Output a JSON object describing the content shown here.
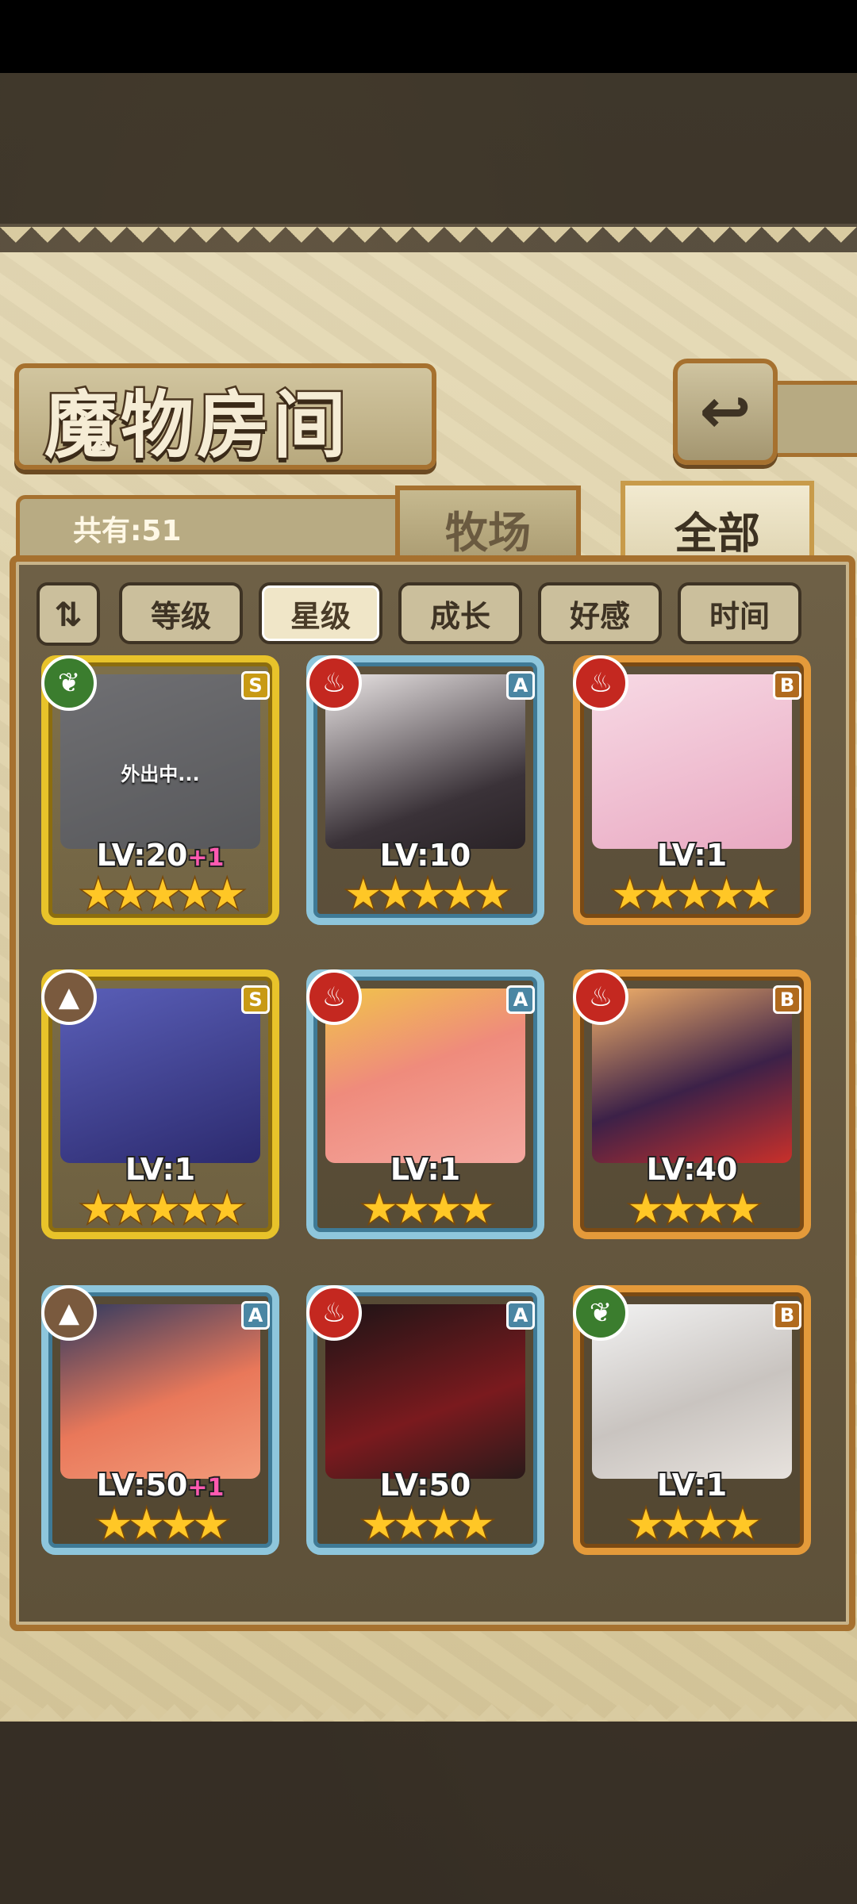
{
  "title": "魔物房间",
  "back_icon": "return-arrow-icon",
  "count": {
    "label": "共有:51"
  },
  "tabs": [
    {
      "label": "牧场",
      "active": false
    },
    {
      "label": "全部",
      "active": true
    }
  ],
  "sort_icon": "sort-order-icon",
  "sort_buttons": [
    {
      "label": "等级",
      "active": false
    },
    {
      "label": "星级",
      "active": true
    },
    {
      "label": "成长",
      "active": false
    },
    {
      "label": "好感",
      "active": false
    },
    {
      "label": "时间",
      "active": false
    }
  ],
  "colors": {
    "frame_S": "#e8c32a",
    "frame_A": "#8ec6dc",
    "frame_B": "#e49a3a",
    "element_green": "#3b7d2e",
    "element_red": "#c42820",
    "element_brown": "#7a5a3e",
    "bonus": "#ff5ab0"
  },
  "monsters": [
    {
      "rank": "S",
      "element": "leaf-element-icon",
      "level": "LV:20",
      "bonus": "+1",
      "stars": "★★★★★",
      "status": "外出中..."
    },
    {
      "rank": "A",
      "element": "fire-element-icon",
      "level": "LV:10",
      "bonus": "",
      "stars": "★★★★★",
      "status": ""
    },
    {
      "rank": "B",
      "element": "fire-element-icon",
      "level": "LV:1",
      "bonus": "",
      "stars": "★★★★★",
      "status": ""
    },
    {
      "rank": "S",
      "element": "mountain-element-icon",
      "level": "LV:1",
      "bonus": "",
      "stars": "★★★★★",
      "status": ""
    },
    {
      "rank": "A",
      "element": "fire-element-icon",
      "level": "LV:1",
      "bonus": "",
      "stars": "★★★★",
      "status": ""
    },
    {
      "rank": "B",
      "element": "fire-element-icon",
      "level": "LV:40",
      "bonus": "",
      "stars": "★★★★",
      "status": ""
    },
    {
      "rank": "A",
      "element": "mountain-element-icon",
      "level": "LV:50",
      "bonus": "+1",
      "stars": "★★★★",
      "status": ""
    },
    {
      "rank": "A",
      "element": "fire-element-icon",
      "level": "LV:50",
      "bonus": "",
      "stars": "★★★★",
      "status": ""
    },
    {
      "rank": "B",
      "element": "leaf-element-icon",
      "level": "LV:1",
      "bonus": "",
      "stars": "★★★★",
      "status": ""
    }
  ]
}
